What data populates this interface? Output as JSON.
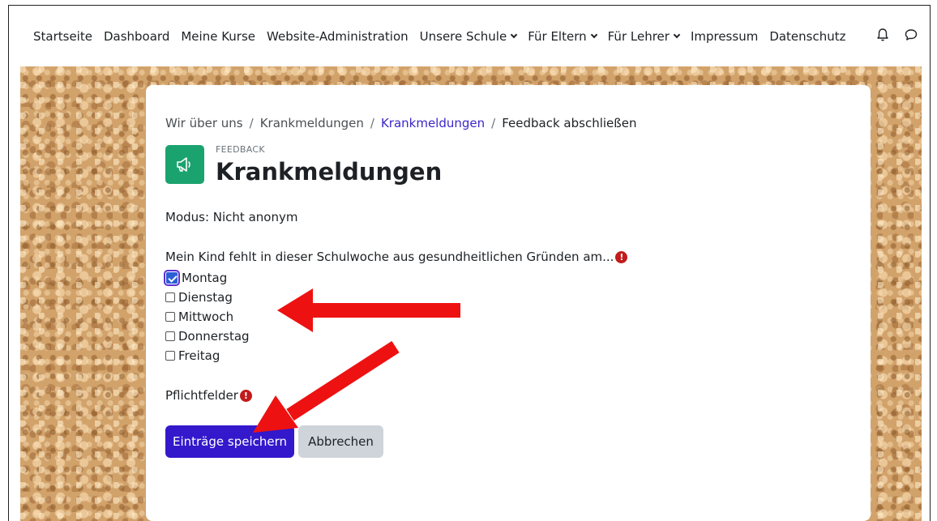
{
  "navbar": {
    "items": [
      {
        "label": "Startseite",
        "dropdown": false
      },
      {
        "label": "Dashboard",
        "dropdown": false
      },
      {
        "label": "Meine Kurse",
        "dropdown": false
      },
      {
        "label": "Website-Administration",
        "dropdown": false
      },
      {
        "label": "Unsere Schule",
        "dropdown": true
      },
      {
        "label": "Für Eltern",
        "dropdown": true
      },
      {
        "label": "Für Lehrer",
        "dropdown": true
      },
      {
        "label": "Impressum",
        "dropdown": false
      },
      {
        "label": "Datenschutz",
        "dropdown": false
      }
    ],
    "icons": [
      "bell-icon",
      "chat-bubble-icon"
    ]
  },
  "breadcrumb": {
    "items": [
      "Wir über uns",
      "Krankmeldungen",
      "Krankmeldungen",
      "Feedback abschließen"
    ],
    "separator": "/"
  },
  "module": {
    "type_label": "FEEDBACK",
    "title": "Krankmeldungen",
    "icon": "megaphone-icon",
    "icon_color": "#1ba36f"
  },
  "mode_text": "Modus: Nicht anonym",
  "question": {
    "text": "Mein Kind fehlt in dieser Schulwoche aus gesundheitlichen Gründen am...",
    "required_icon": "!",
    "options": [
      {
        "label": "Montag",
        "checked": true
      },
      {
        "label": "Dienstag",
        "checked": false
      },
      {
        "label": "Mittwoch",
        "checked": false
      },
      {
        "label": "Donnerstag",
        "checked": false
      },
      {
        "label": "Freitag",
        "checked": false
      }
    ]
  },
  "required_note": "Pflichtfelder",
  "buttons": {
    "save": "Einträge speichern",
    "cancel": "Abbrechen"
  },
  "colors": {
    "primary": "#3318cc",
    "required": "#c11b1b",
    "link": "#3b27c9",
    "annotation_arrow": "#ee1111"
  }
}
